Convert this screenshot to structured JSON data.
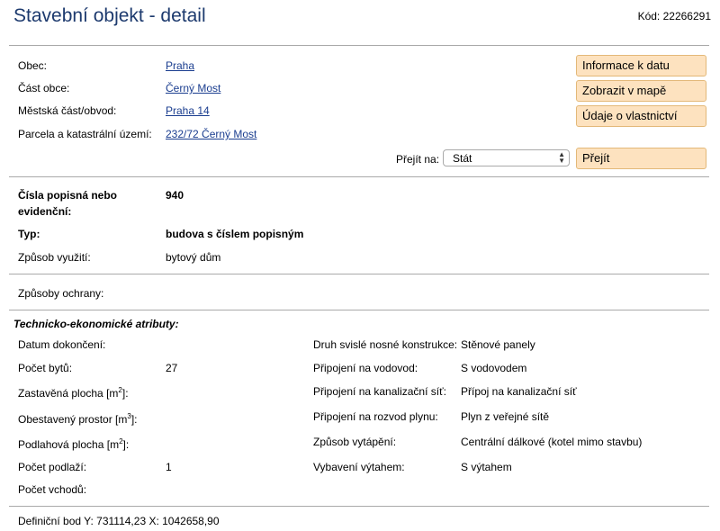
{
  "header": {
    "title": "Stavební objekt - detail",
    "code": "Kód: 22266291"
  },
  "location": {
    "obec_label": "Obec:",
    "obec_value": "Praha",
    "cast_obce_label": "Část obce:",
    "cast_obce_value": "Černý Most",
    "mestska_cast_label": "Městská část/obvod:",
    "mestska_cast_value": "Praha 14",
    "parcela_label": "Parcela a katastrální území:",
    "parcela_value": "232/72 Černý Most"
  },
  "actions": {
    "info_button": "Informace k datu",
    "map_button": "Zobrazit v mapě",
    "owner_button": "Údaje o vlastnictví",
    "goto_label": "Přejít na:",
    "goto_selected": "Stát",
    "goto_button": "Přejít"
  },
  "building": {
    "cislo_label_1": "Čísla popisná nebo",
    "cislo_label_2": "evidenční:",
    "cislo_value": "940",
    "typ_label": "Typ:",
    "typ_value": "budova s číslem popisným",
    "vyuziti_label": "Způsob využití:",
    "vyuziti_value": "bytový dům"
  },
  "protection": {
    "label": "Způsoby ochrany:"
  },
  "technical": {
    "section_title": "Technicko-ekonomické atributy:",
    "left": {
      "dokonceni_label": "Datum dokončení:",
      "pocet_bytu_label": "Počet bytů:",
      "pocet_bytu_value": "27",
      "zastavena_label": "Zastavěná plocha [m",
      "zastavena_sup": "2",
      "zastavena_suffix": "]:",
      "obestaveny_label": "Obestavený prostor [m",
      "obestaveny_sup": "3",
      "obestaveny_suffix": "]:",
      "podlahova_label": "Podlahová plocha [m",
      "podlahova_sup": "2",
      "podlahova_suffix": "]:",
      "podlazi_label": "Počet podlaží:",
      "podlazi_value": "1",
      "vchodu_label": "Počet vchodů:"
    },
    "right": {
      "konstrukce_label": "Druh svislé nosné konstrukce:",
      "konstrukce_value": "Stěnové panely",
      "vodovod_label": "Připojení na vodovod:",
      "vodovod_value": "S vodovodem",
      "kanalizace_label": "Připojení na kanalizační síť:",
      "kanalizace_value": "Přípoj na kanalizační síť",
      "plyn_label": "Připojení na rozvod plynu:",
      "plyn_value": "Plyn z veřejné sítě",
      "vytapeni_label": "Způsob vytápění:",
      "vytapeni_value": "Centrální dálkové (kotel mimo stavbu)",
      "vytah_label": "Vybavení výtahem:",
      "vytah_value": "S výtahem"
    }
  },
  "footer": {
    "definicni_bod": "Definiční bod Y: 731114,23 X: 1042658,90"
  }
}
